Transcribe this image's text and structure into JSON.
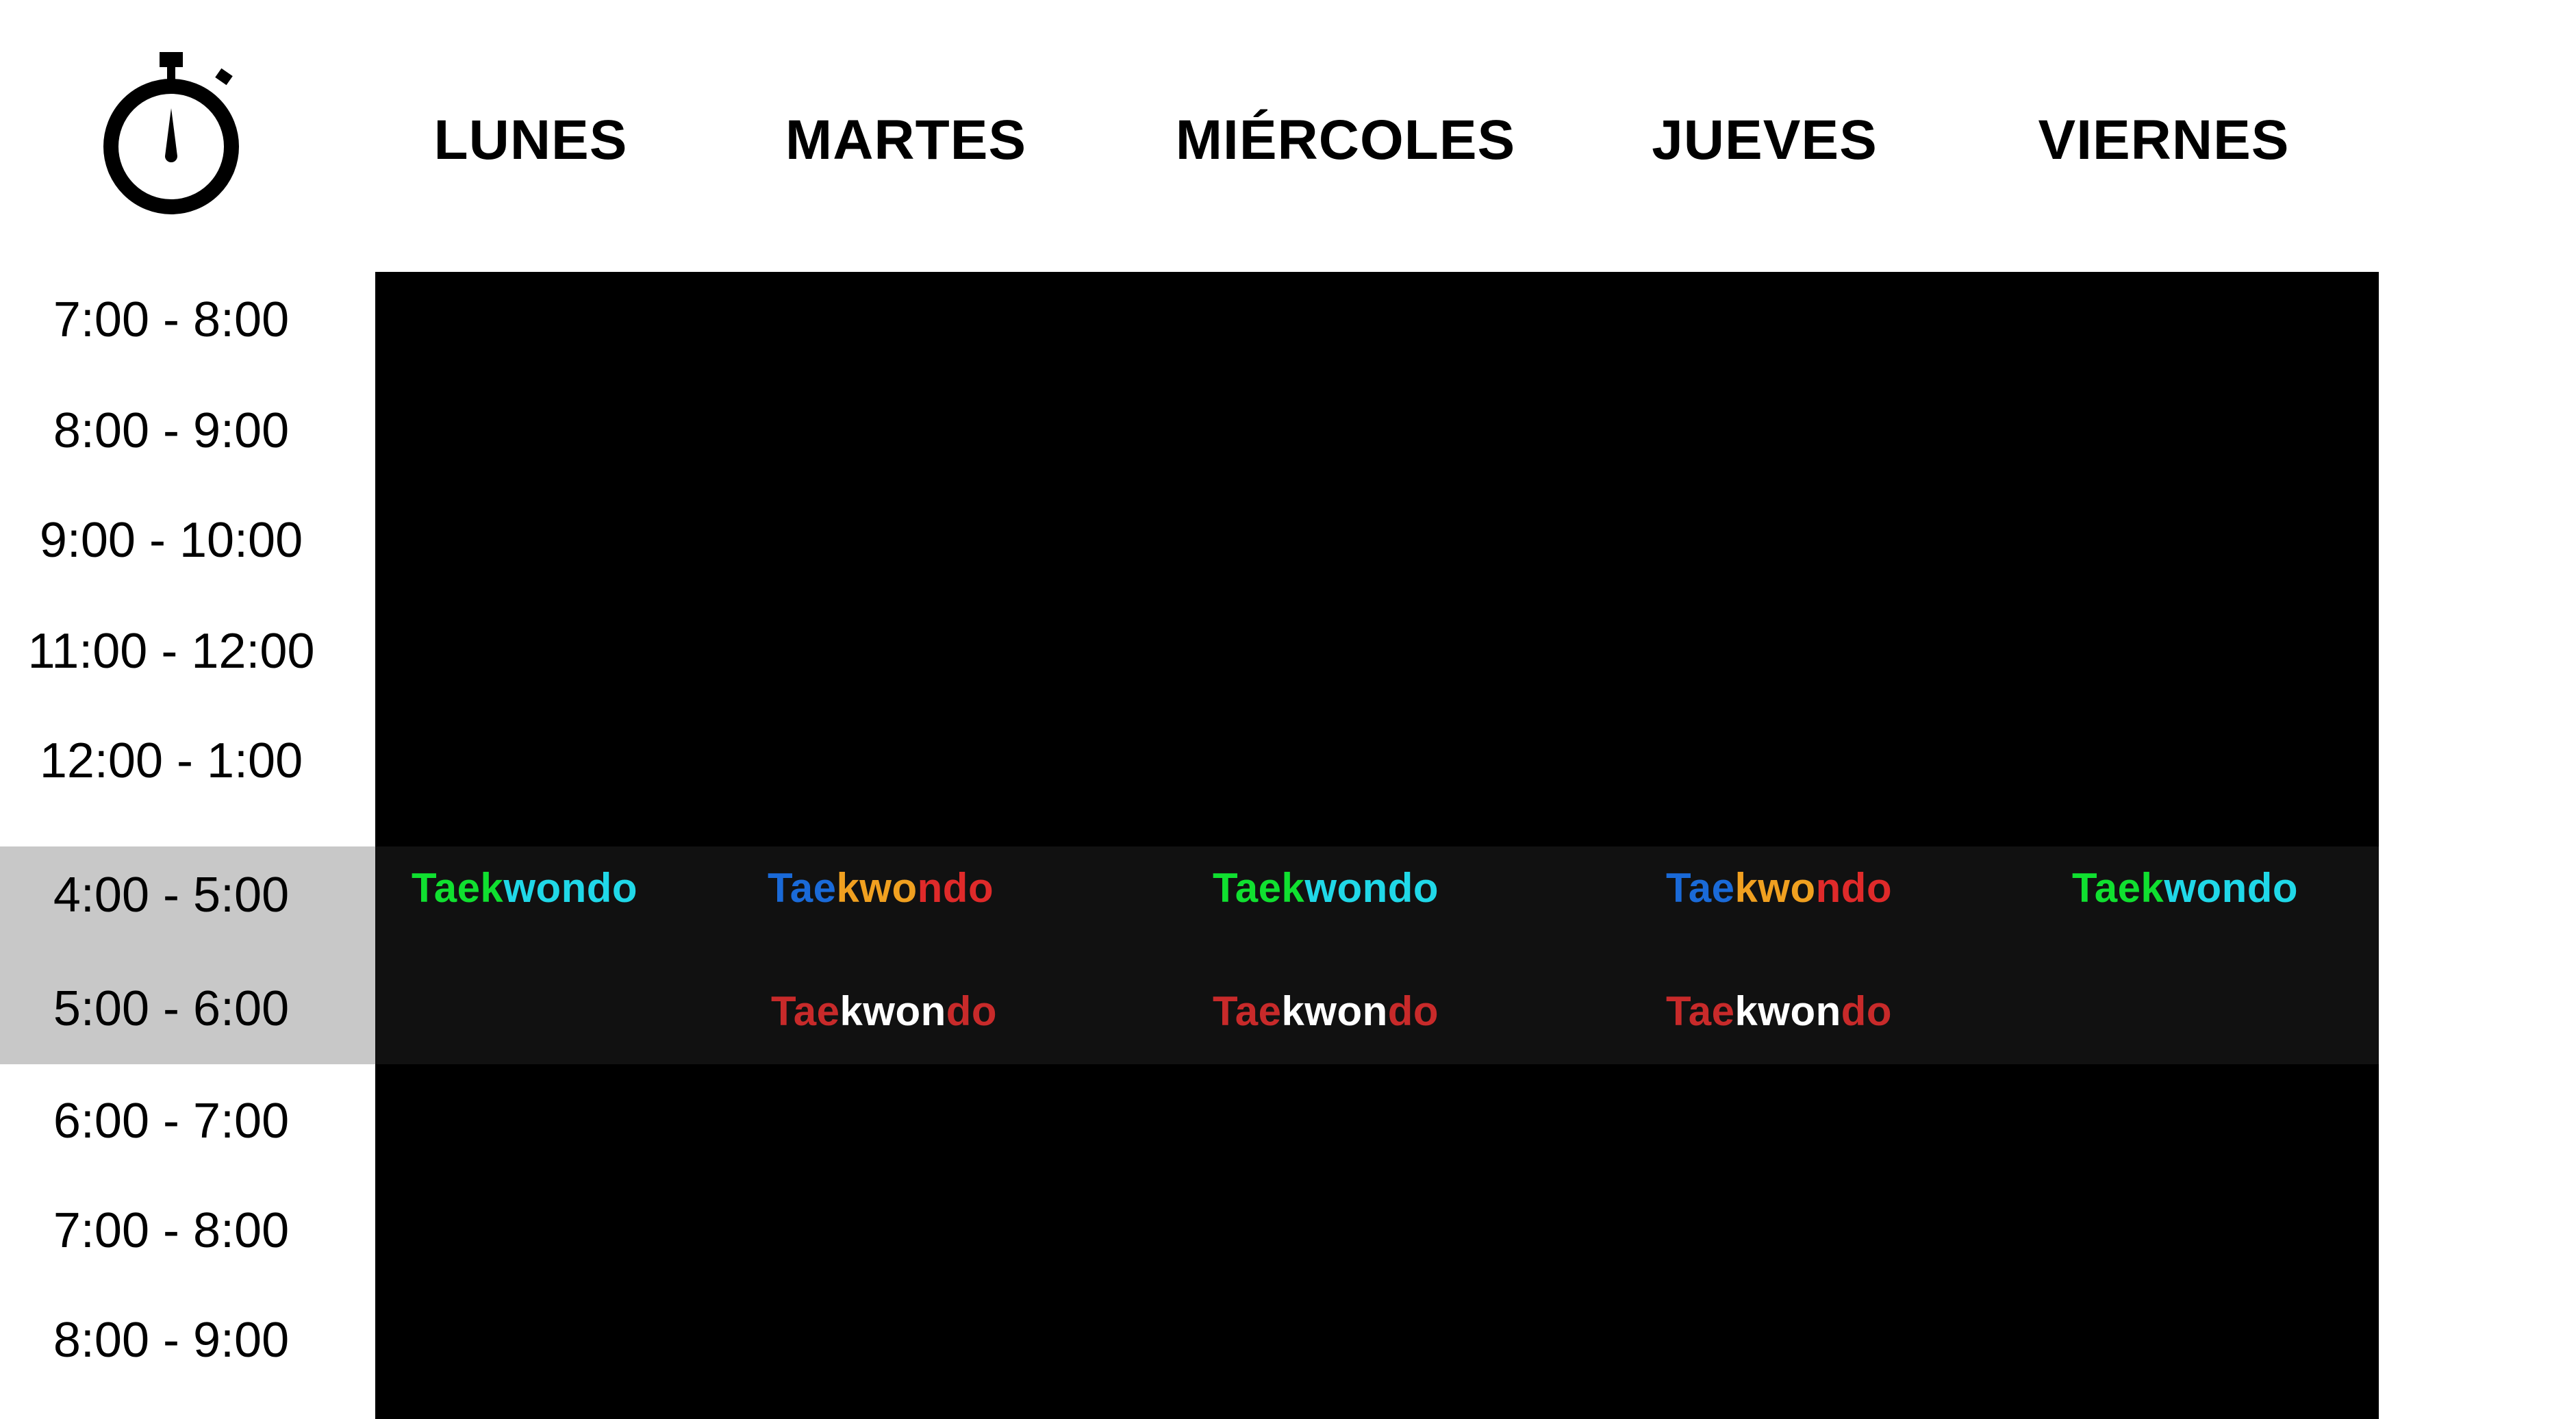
{
  "header": {
    "icon": "stopwatch-icon",
    "days": [
      "LUNES",
      "MARTES",
      "MIÉRCOLES",
      "JUEVES",
      "VIERNES"
    ]
  },
  "times": [
    "7:00 - 8:00",
    "8:00 - 9:00",
    "9:00 - 10:00",
    "11:00 - 12:00",
    "12:00 - 1:00",
    "4:00 - 5:00",
    "5:00 - 6:00",
    "6:00 - 7:00",
    "7:00 - 8:00",
    "8:00 - 9:00"
  ],
  "colors": {
    "green": "#10e030",
    "cyan": "#20d8e8",
    "blue": "#1a6ad8",
    "orange": "#f0a020",
    "red": "#e02a2a",
    "darkred": "#c82a2a",
    "white": "#ffffff",
    "grid_black": "#000000",
    "band": "#111111",
    "time_highlight": "#c8c8c8"
  },
  "classes": {
    "row_4_5": [
      {
        "day": "LUNES",
        "text": "Taekwondo",
        "parts": [
          {
            "t": "Taek",
            "c": "green"
          },
          {
            "t": "wondo",
            "c": "cyan"
          }
        ]
      },
      {
        "day": "MARTES",
        "text": "Taekwondo",
        "parts": [
          {
            "t": "Tae",
            "c": "blue"
          },
          {
            "t": "kwo",
            "c": "orange"
          },
          {
            "t": "ndo",
            "c": "red"
          }
        ]
      },
      {
        "day": "MIÉRCOLES",
        "text": "Taekwondo",
        "parts": [
          {
            "t": "Taek",
            "c": "green"
          },
          {
            "t": "wondo",
            "c": "cyan"
          }
        ]
      },
      {
        "day": "JUEVES",
        "text": "Taekwondo",
        "parts": [
          {
            "t": "Tae",
            "c": "blue"
          },
          {
            "t": "kwo",
            "c": "orange"
          },
          {
            "t": "ndo",
            "c": "red"
          }
        ]
      },
      {
        "day": "VIERNES",
        "text": "Taekwondo",
        "parts": [
          {
            "t": "Taek",
            "c": "green"
          },
          {
            "t": "wondo",
            "c": "cyan"
          }
        ]
      }
    ],
    "row_5_6": [
      {
        "day": "MARTES",
        "text": "Taekwondo",
        "parts": [
          {
            "t": "Tae",
            "c": "darkred"
          },
          {
            "t": "kwon",
            "c": "white"
          },
          {
            "t": "do",
            "c": "darkred"
          }
        ]
      },
      {
        "day": "MIÉRCOLES",
        "text": "Taekwondo",
        "parts": [
          {
            "t": "Tae",
            "c": "darkred"
          },
          {
            "t": "kwon",
            "c": "white"
          },
          {
            "t": "do",
            "c": "darkred"
          }
        ]
      },
      {
        "day": "JUEVES",
        "text": "Taekwondo",
        "parts": [
          {
            "t": "Tae",
            "c": "darkred"
          },
          {
            "t": "kwon",
            "c": "white"
          },
          {
            "t": "do",
            "c": "darkred"
          }
        ]
      }
    ]
  }
}
